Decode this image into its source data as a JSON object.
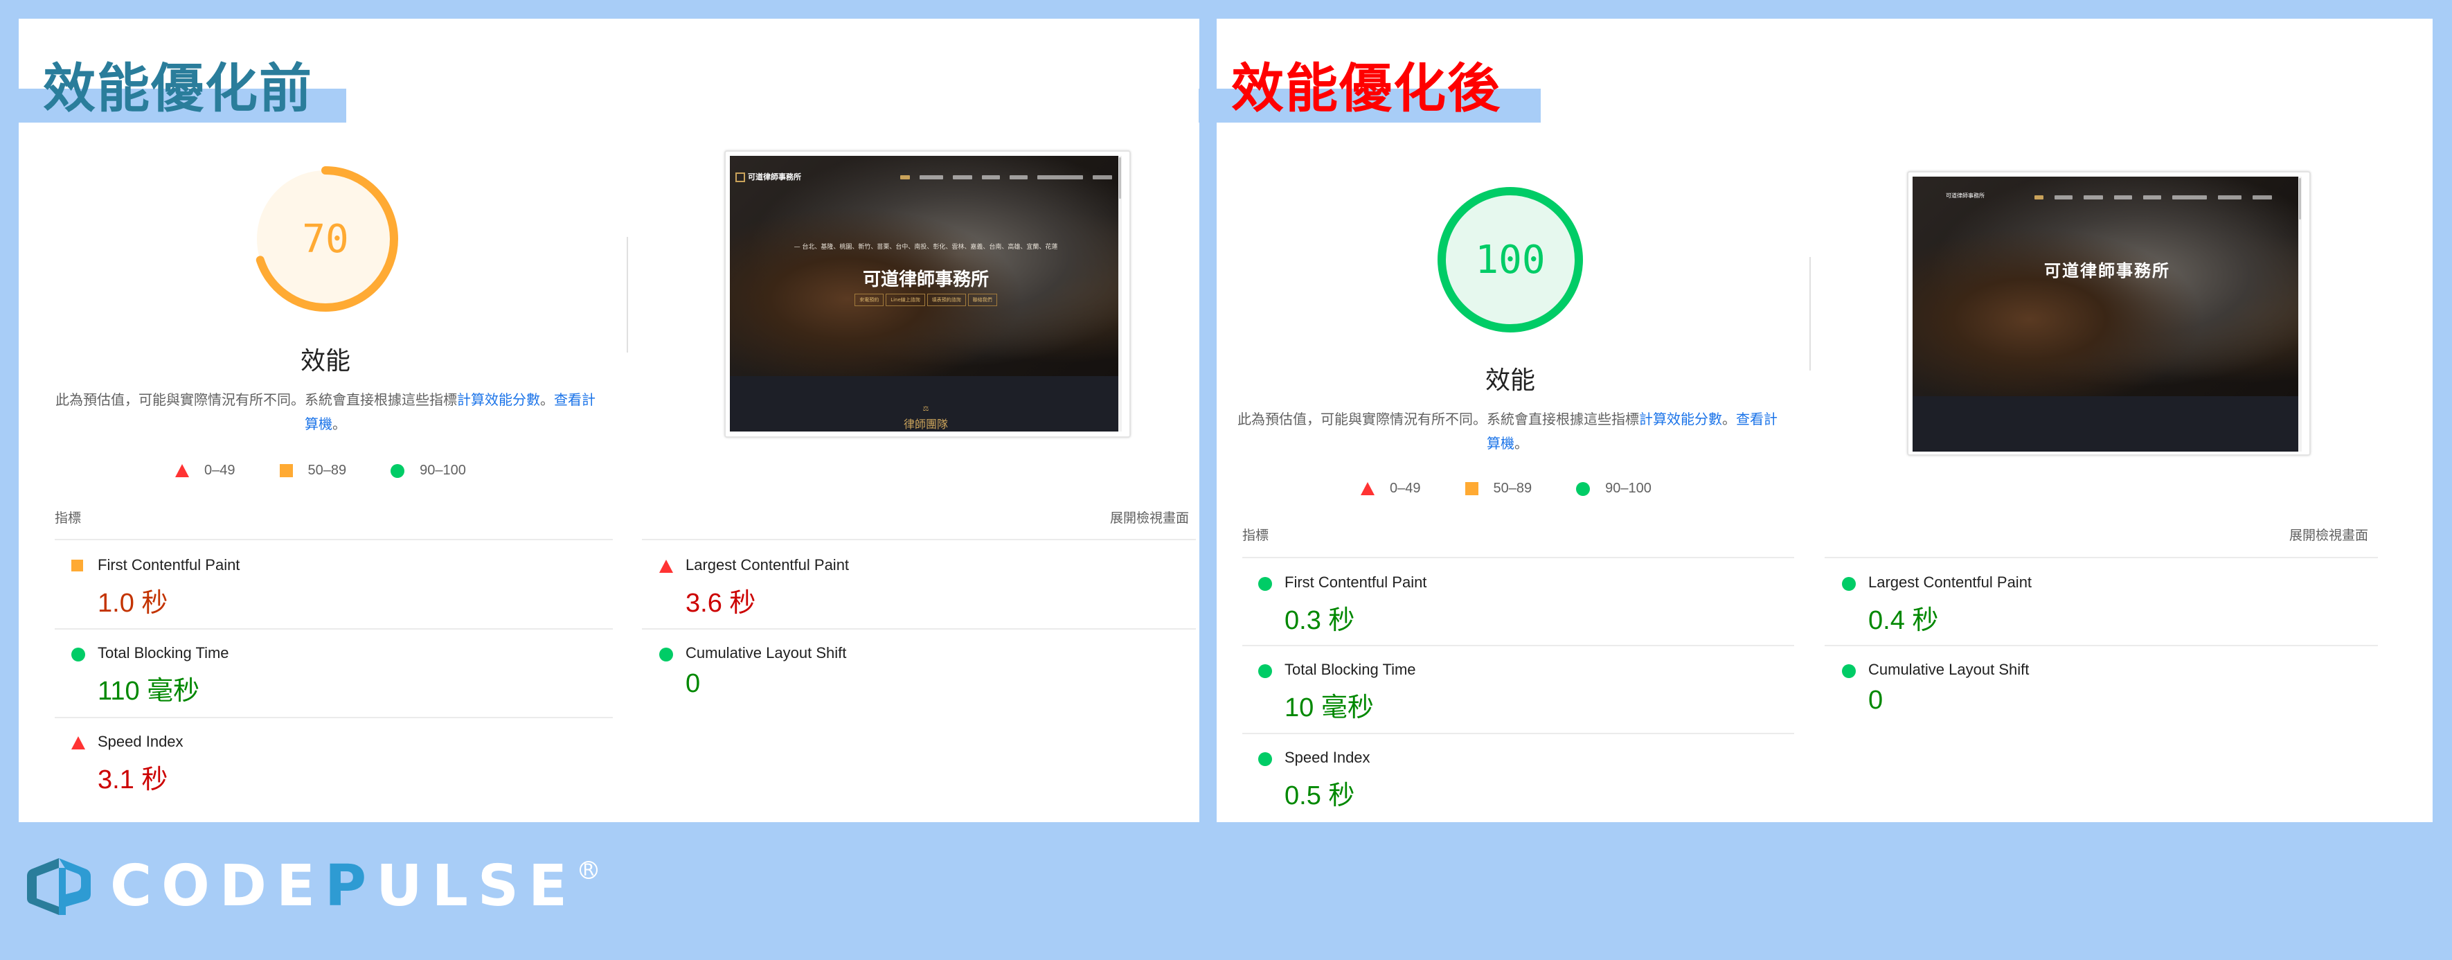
{
  "colors": {
    "background": "#a8cdf7",
    "title_before": "#2a7d9b",
    "title_after": "#ff0000",
    "fail": "#ff3333",
    "average": "#ffaa33",
    "pass": "#00cc66",
    "value_fail": "#cc0000",
    "value_average": "#c33300",
    "value_pass": "#008800",
    "link": "#1a73e8"
  },
  "panels": [
    {
      "id": "before",
      "title": "效能優化前",
      "score": 70,
      "score_text": "70",
      "rating": "average",
      "category_title": "效能",
      "description": {
        "text": "此為預估值，可能與實際情況有所不同。系統會直接根據這些指標",
        "link1": "計算效能分數",
        "sep": "。",
        "link2": "查看計算機",
        "end": "。"
      },
      "legend": [
        {
          "shape": "triangle",
          "range": "0–49"
        },
        {
          "shape": "square",
          "range": "50–89"
        },
        {
          "shape": "circle",
          "range": "90–100"
        }
      ],
      "metrics_header": "指標",
      "expand_view": "展開檢視畫面",
      "metrics": [
        {
          "name": "First Contentful Paint",
          "value": "1.0 秒",
          "rating": "average"
        },
        {
          "name": "Largest Contentful Paint",
          "value": "3.6 秒",
          "rating": "fail"
        },
        {
          "name": "Total Blocking Time",
          "value": "110 毫秒",
          "rating": "pass"
        },
        {
          "name": "Cumulative Layout Shift",
          "value": "0",
          "rating": "pass"
        },
        {
          "name": "Speed Index",
          "value": "3.1 秒",
          "rating": "fail"
        }
      ],
      "screenshot": {
        "site_logo": "可道律師事務所",
        "cities": "— 台北、基隆、桃園、新竹、苗栗、台中、南投、彰化、雲林、嘉義、台南、高雄、宜蘭、花蓮",
        "hero_title": "可道律師事務所",
        "cta_buttons": [
          "來電預約",
          "Line線上諮詢",
          "填表預約諮詢",
          "聯絡我們"
        ],
        "section_title": "律師團隊"
      }
    },
    {
      "id": "after",
      "title": "效能優化後",
      "score": 100,
      "score_text": "100",
      "rating": "pass",
      "category_title": "效能",
      "description": {
        "text": "此為預估值，可能與實際情況有所不同。系統會直接根據這些指標",
        "link1": "計算效能分數",
        "sep": "。",
        "link2": "查看計算機",
        "end": "。"
      },
      "legend": [
        {
          "shape": "triangle",
          "range": "0–49"
        },
        {
          "shape": "square",
          "range": "50–89"
        },
        {
          "shape": "circle",
          "range": "90–100"
        }
      ],
      "metrics_header": "指標",
      "expand_view": "展開檢視畫面",
      "metrics": [
        {
          "name": "First Contentful Paint",
          "value": "0.3 秒",
          "rating": "pass"
        },
        {
          "name": "Largest Contentful Paint",
          "value": "0.4 秒",
          "rating": "pass"
        },
        {
          "name": "Total Blocking Time",
          "value": "10 毫秒",
          "rating": "pass"
        },
        {
          "name": "Cumulative Layout Shift",
          "value": "0",
          "rating": "pass"
        },
        {
          "name": "Speed Index",
          "value": "0.5 秒",
          "rating": "pass"
        }
      ],
      "screenshot": {
        "site_logo": "可道律師事務所",
        "hero_title": "可道律師事務所"
      }
    }
  ],
  "brand": {
    "name_part1": "CODE",
    "name_part2": "P",
    "name_part3": "ULSE",
    "registered": "R",
    "icon": "codepulse-logo-icon"
  }
}
